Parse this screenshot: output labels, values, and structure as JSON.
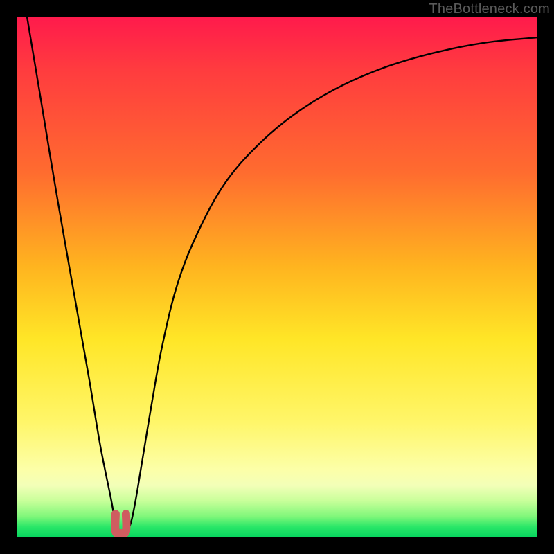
{
  "watermark": "TheBottleneck.com",
  "chart_data": {
    "type": "line",
    "title": "",
    "xlabel": "",
    "ylabel": "",
    "xlim": [
      0,
      100
    ],
    "ylim": [
      0,
      100
    ],
    "grid": false,
    "legend": false,
    "annotations": [],
    "series": [
      {
        "name": "bottleneck-curve",
        "color": "#000000",
        "x": [
          2,
          5,
          8,
          11,
          14,
          16,
          18,
          19,
          20,
          21,
          22,
          23,
          24,
          26,
          28,
          31,
          35,
          40,
          46,
          53,
          61,
          70,
          80,
          90,
          100
        ],
        "y": [
          100,
          82,
          64,
          47,
          30,
          18,
          8,
          3,
          1,
          1,
          3,
          8,
          14,
          26,
          37,
          49,
          59,
          68,
          75,
          81,
          86,
          90,
          93,
          95,
          96
        ]
      },
      {
        "name": "minimum-marker",
        "color": "#cf5d60",
        "x": [
          19,
          19,
          20,
          21,
          21
        ],
        "y": [
          4.5,
          1.2,
          0.8,
          1.2,
          4.5
        ]
      }
    ],
    "background_gradient": {
      "top": "#ff1a4c",
      "upper_mid": "#ffb41f",
      "mid": "#ffe627",
      "lower_mid": "#fcffa8",
      "bottom": "#06d45e"
    }
  }
}
